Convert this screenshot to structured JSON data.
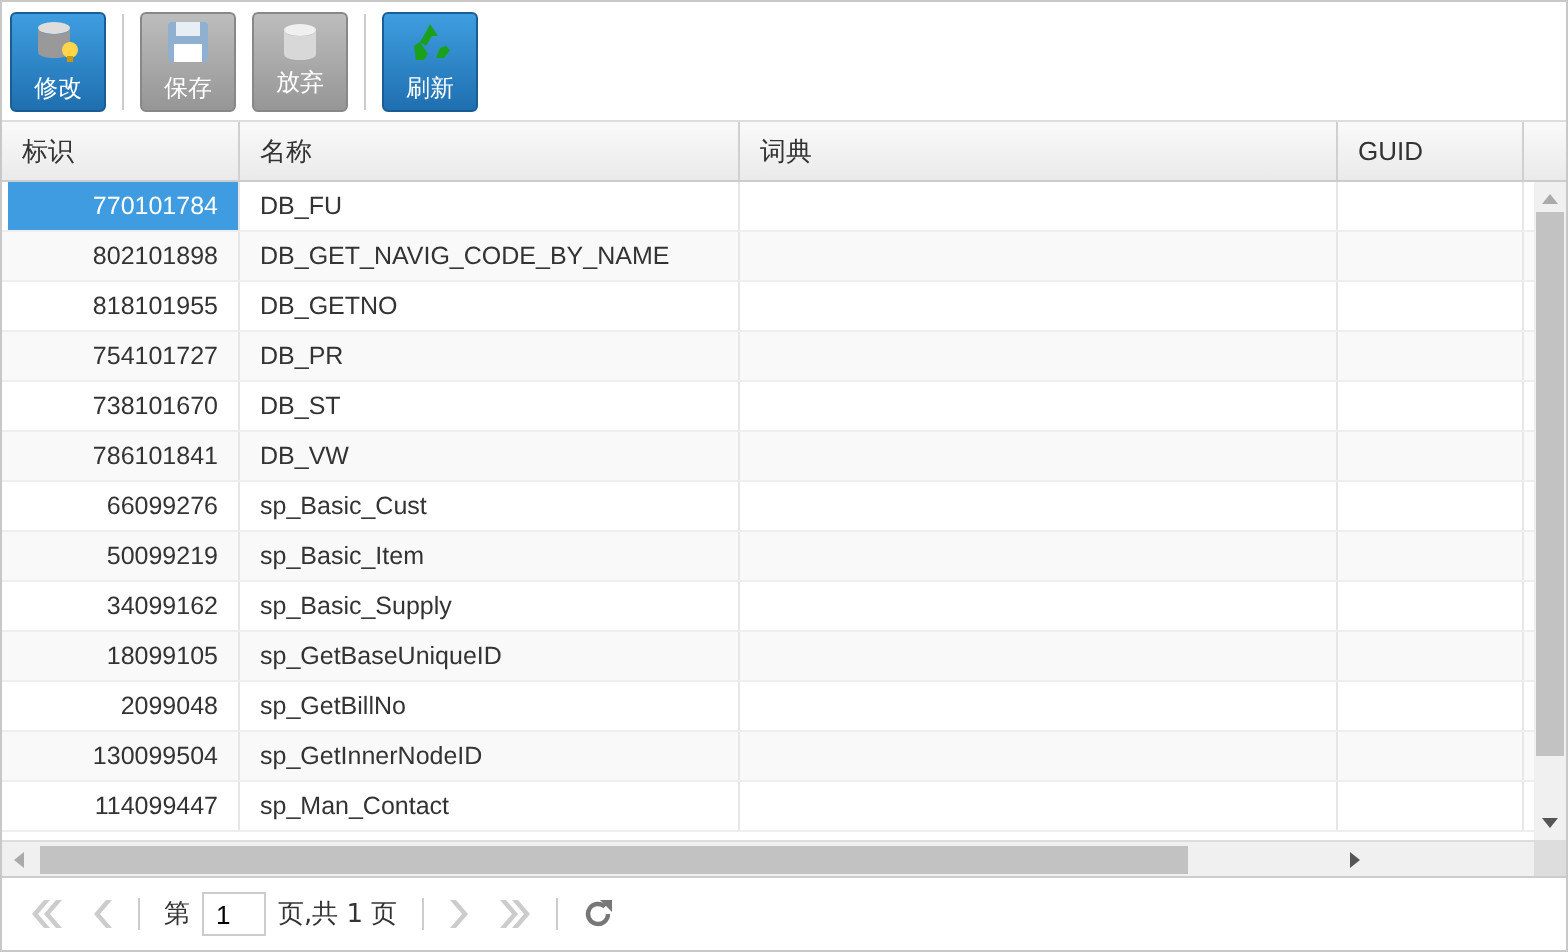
{
  "toolbar": {
    "buttons": [
      {
        "kind": "edit",
        "label": "修改",
        "disabled": false
      },
      {
        "kind": "save",
        "label": "保存",
        "disabled": true
      },
      {
        "kind": "discard",
        "label": "放弃",
        "disabled": true
      },
      {
        "kind": "refresh",
        "label": "刷新",
        "disabled": false
      }
    ]
  },
  "table": {
    "columns": [
      "标识",
      "名称",
      "词典",
      "GUID"
    ],
    "rows": [
      {
        "id": "770101784",
        "name": "DB_FU",
        "selected": true
      },
      {
        "id": "802101898",
        "name": "DB_GET_NAVIG_CODE_BY_NAME",
        "selected": false
      },
      {
        "id": "818101955",
        "name": "DB_GETNO",
        "selected": false
      },
      {
        "id": "754101727",
        "name": "DB_PR",
        "selected": false
      },
      {
        "id": "738101670",
        "name": "DB_ST",
        "selected": false
      },
      {
        "id": "786101841",
        "name": "DB_VW",
        "selected": false
      },
      {
        "id": "66099276",
        "name": "sp_Basic_Cust",
        "selected": false
      },
      {
        "id": "50099219",
        "name": "sp_Basic_Item",
        "selected": false
      },
      {
        "id": "34099162",
        "name": "sp_Basic_Supply",
        "selected": false
      },
      {
        "id": "18099105",
        "name": "sp_GetBaseUniqueID",
        "selected": false
      },
      {
        "id": "2099048",
        "name": "sp_GetBillNo",
        "selected": false
      },
      {
        "id": "130099504",
        "name": "sp_GetInnerNodeID",
        "selected": false
      },
      {
        "id": "114099447",
        "name": "sp_Man_Contact",
        "selected": false
      }
    ]
  },
  "pager": {
    "page_prefix": "第",
    "page_value": "1",
    "page_suffix": "页,共 1 页"
  }
}
